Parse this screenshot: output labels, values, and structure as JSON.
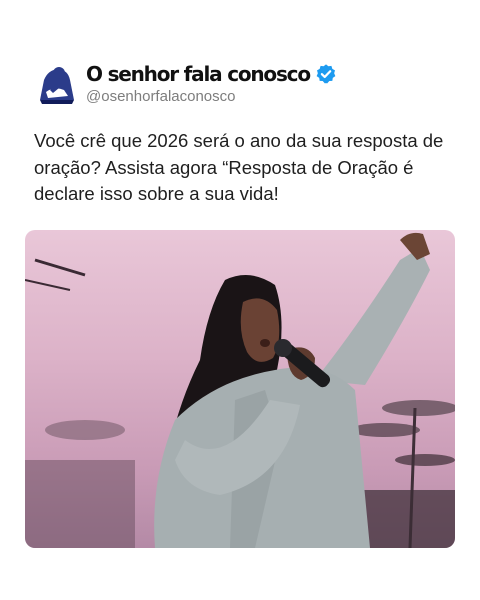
{
  "account": {
    "display_name": "O senhor fala conosco",
    "handle": "@osenhorfalaconosco",
    "avatar_icon": "praying-person-logo-icon",
    "verified_icon": "verified-badge-icon",
    "verified_color": "#1d9bf0"
  },
  "post": {
    "text": "Você crê que 2026 será o ano da sua resposta de oração? Assista agora “Resposta de Oração é declare isso sobre a sua vida!"
  },
  "media": {
    "type": "video-frame",
    "alt_subject": "singer-with-microphone"
  }
}
